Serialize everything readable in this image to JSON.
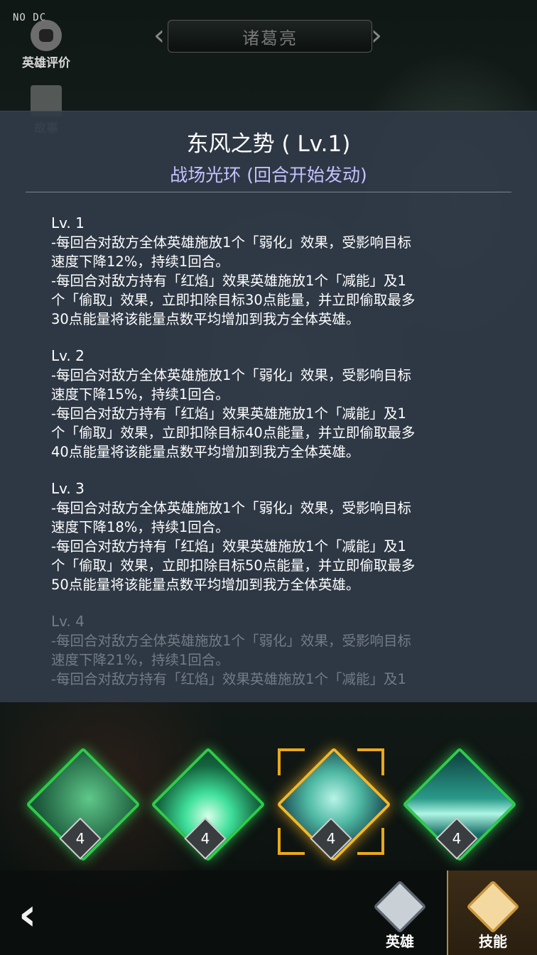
{
  "debug_label": "NO DC",
  "side_buttons": {
    "hero_review": "英雄评价",
    "story": "故事"
  },
  "hero_name": "诸葛亮",
  "skill": {
    "title": "东风之势 ( Lv.1)",
    "subtitle": "战场光环 (回合开始发动)",
    "levels": [
      {
        "label": "Lv. 1",
        "lines": [
          "-每回合对敌方全体英雄施放1个「弱化」效果，受影响目标",
          "速度下降12%，持续1回合。",
          "-每回合对敌方持有「红焰」效果英雄施放1个「减能」及1",
          "个「偷取」效果，立即扣除目标30点能量，并立即偷取最多",
          "30点能量将该能量点数平均增加到我方全体英雄。"
        ]
      },
      {
        "label": "Lv. 2",
        "lines": [
          "-每回合对敌方全体英雄施放1个「弱化」效果，受影响目标",
          "速度下降15%，持续1回合。",
          "-每回合对敌方持有「红焰」效果英雄施放1个「减能」及1",
          "个「偷取」效果，立即扣除目标40点能量，并立即偷取最多",
          "40点能量将该能量点数平均增加到我方全体英雄。"
        ]
      },
      {
        "label": "Lv. 3",
        "lines": [
          "-每回合对敌方全体英雄施放1个「弱化」效果，受影响目标",
          "速度下降18%，持续1回合。",
          "-每回合对敌方持有「红焰」效果英雄施放1个「减能」及1",
          "个「偷取」效果，立即扣除目标50点能量，并立即偷取最多",
          "50点能量将该能量点数平均增加到我方全体英雄。"
        ]
      },
      {
        "label": "Lv. 4",
        "lines": [
          "-每回合对敌方全体英雄施放1个「弱化」效果，受影响目标",
          "速度下降21%，持续1回合。",
          "-每回合对敌方持有「红焰」效果英雄施放1个「减能」及1"
        ]
      }
    ]
  },
  "skill_icons": [
    {
      "level": "4",
      "selected": false,
      "icon": "green-sparkle-icon"
    },
    {
      "level": "4",
      "selected": false,
      "icon": "green-flame-icon"
    },
    {
      "level": "4",
      "selected": true,
      "icon": "wind-swirl-icon"
    },
    {
      "level": "4",
      "selected": false,
      "icon": "forest-lake-icon"
    }
  ],
  "bottom_tabs": {
    "hero": "英雄",
    "skill": "技能"
  },
  "colors": {
    "subtitle": "#c6c2ff",
    "selected_border": "#f3b827",
    "skill_border": "#2fcb4c"
  }
}
